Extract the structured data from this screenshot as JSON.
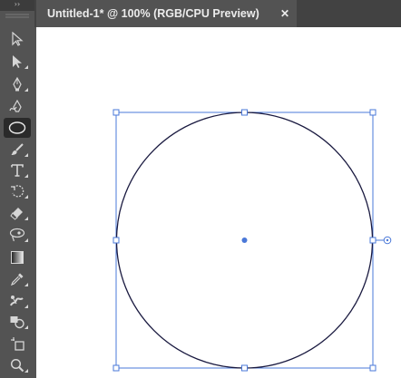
{
  "document_tab": {
    "title": "Untitled-1* @ 100% (RGB/CPU Preview)",
    "close_glyph": "✕"
  },
  "toolbar": {
    "collapse_glyph": "››",
    "tools": [
      {
        "name": "selection-tool",
        "icon": "selection-arrow-icon"
      },
      {
        "name": "direct-selection-tool",
        "icon": "direct-selection-arrow-icon"
      },
      {
        "name": "pen-tool",
        "icon": "pen-icon"
      },
      {
        "name": "curvature-tool",
        "icon": "curvature-pen-icon"
      },
      {
        "name": "ellipse-tool",
        "icon": "ellipse-icon",
        "active": true
      },
      {
        "name": "paintbrush-tool",
        "icon": "paintbrush-icon"
      },
      {
        "name": "type-tool",
        "icon": "type-icon",
        "glyph": "T"
      },
      {
        "name": "rotate-tool",
        "icon": "rotate-icon"
      },
      {
        "name": "eraser-tool",
        "icon": "eraser-icon"
      },
      {
        "name": "lasso-tool",
        "icon": "lasso-icon"
      },
      {
        "name": "gradient-tool",
        "icon": "gradient-icon"
      },
      {
        "name": "eyedropper-tool",
        "icon": "eyedropper-icon"
      },
      {
        "name": "puppet-warp-tool",
        "icon": "puppet-warp-icon"
      },
      {
        "name": "shape-builder-tool",
        "icon": "shape-builder-icon"
      },
      {
        "name": "artboard-tool",
        "icon": "artboard-icon"
      },
      {
        "name": "zoom-tool",
        "icon": "zoom-icon"
      }
    ]
  },
  "colors": {
    "toolbar_bg": "#535353",
    "tabbar_bg": "#424242",
    "canvas_bg": "#ffffff",
    "selection_blue": "#4a78d8",
    "shape_stroke": "#1a1a40"
  }
}
